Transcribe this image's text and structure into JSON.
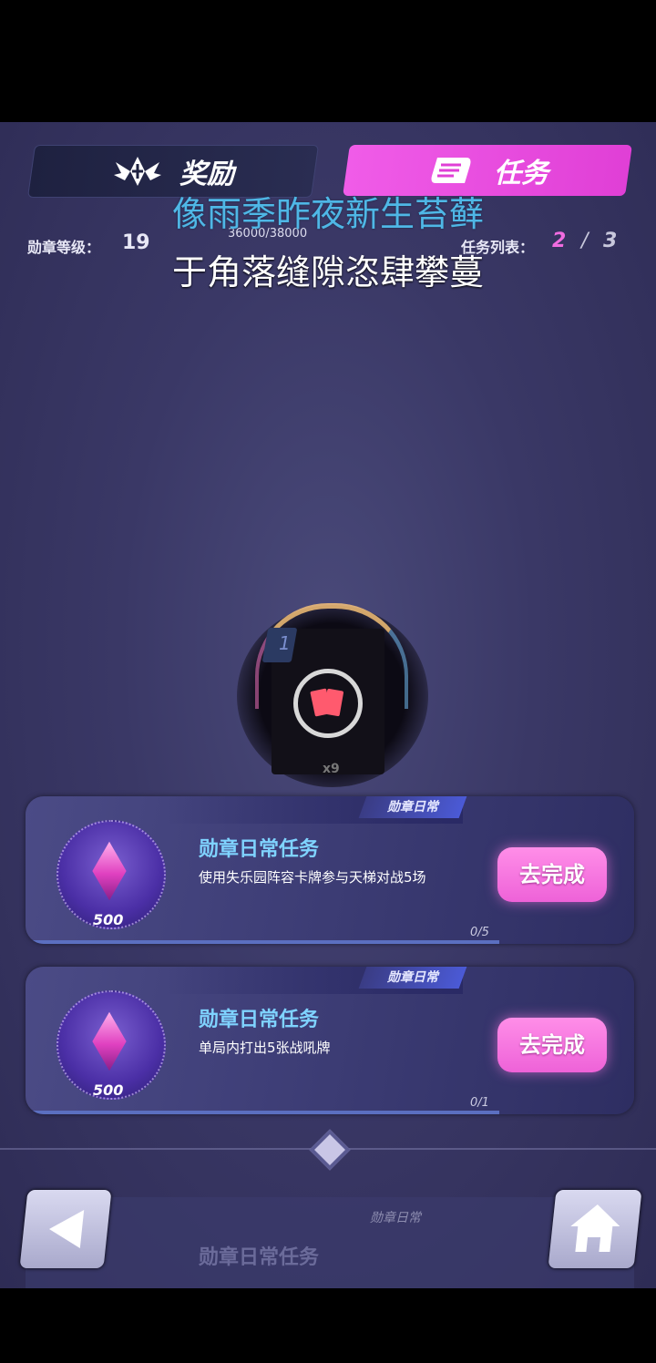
{
  "tabs": [
    {
      "label": "奖励",
      "icon": "winged-emblem-icon",
      "active": false
    },
    {
      "label": "任务",
      "icon": "scroll-icon",
      "active": true
    }
  ],
  "lyrics": {
    "line1": "像雨季昨夜新生苔藓",
    "line2": "于角落缝隙恣肆攀蔓"
  },
  "medal": {
    "level_label": "勋章等级：",
    "level_value": "19",
    "progress_text": "36000/38000"
  },
  "task_list": {
    "label": "任务列表：",
    "current": "2",
    "separator": "/",
    "total": "3"
  },
  "reward_preview": {
    "number": "1",
    "count": "x9",
    "icon": "cards-icon"
  },
  "tasks": [
    {
      "tag": "勋章日常",
      "title": "勋章日常任务",
      "description": "使用失乐园阵容卡牌参与天梯对战5场",
      "reward_amount": "500",
      "progress": "0/5",
      "button_label": "去完成"
    },
    {
      "tag": "勋章日常",
      "title": "勋章日常任务",
      "description": "单局内打出5张战吼牌",
      "reward_amount": "500",
      "progress": "0/1",
      "button_label": "去完成"
    }
  ],
  "ghost_task": {
    "tag": "勋章日常",
    "title": "勋章日常任务"
  },
  "nav": {
    "back_icon": "back-arrow-icon",
    "home_icon": "home-icon"
  },
  "colors": {
    "accent_pink": "#ee62d8",
    "title_blue": "#7fd3ff",
    "lyric_blue": "#4fb7e6"
  }
}
